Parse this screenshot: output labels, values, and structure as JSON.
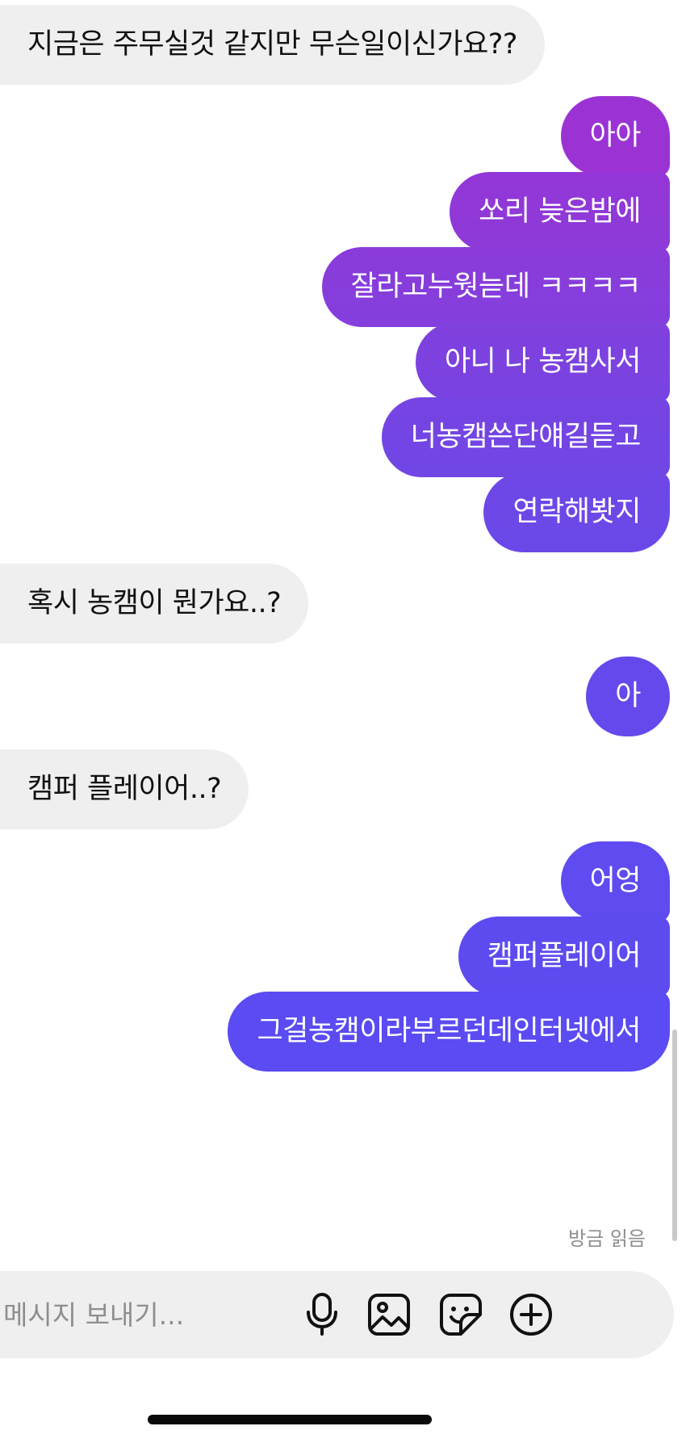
{
  "conversation": {
    "messages": [
      {
        "sender": "other",
        "text": "지금은 주무실것 같지만 무슨일이신가요??"
      },
      {
        "sender": "me",
        "text": "아아"
      },
      {
        "sender": "me",
        "text": "쏘리 늦은밤에"
      },
      {
        "sender": "me",
        "text": "잘라고누웟늗데 ㅋㅋㅋㅋ"
      },
      {
        "sender": "me",
        "text": "아니 나 농캠사서"
      },
      {
        "sender": "me",
        "text": "너농캠쓴단얘길듣고"
      },
      {
        "sender": "me",
        "text": "연락해봣지"
      },
      {
        "sender": "other",
        "text": "혹시 농캠이 뭔가요..?"
      },
      {
        "sender": "me",
        "text": "아"
      },
      {
        "sender": "other",
        "text": "캠퍼 플레이어..?"
      },
      {
        "sender": "me",
        "text": "어엉"
      },
      {
        "sender": "me",
        "text": "캠퍼플레이어"
      },
      {
        "sender": "me",
        "text": "그걸농캠이라부르던데인터넷에서"
      }
    ],
    "read_receipt": "방금 읽음"
  },
  "composer": {
    "placeholder": "메시지 보내기...",
    "icons": [
      "microphone-icon",
      "image-icon",
      "sticker-icon",
      "add-icon"
    ]
  },
  "colors": {
    "received_bubble": "#efeff0",
    "sent_gradient_top": "#9a32d6",
    "sent_gradient_bottom": "#5a48f2",
    "background": "#ffffff"
  }
}
